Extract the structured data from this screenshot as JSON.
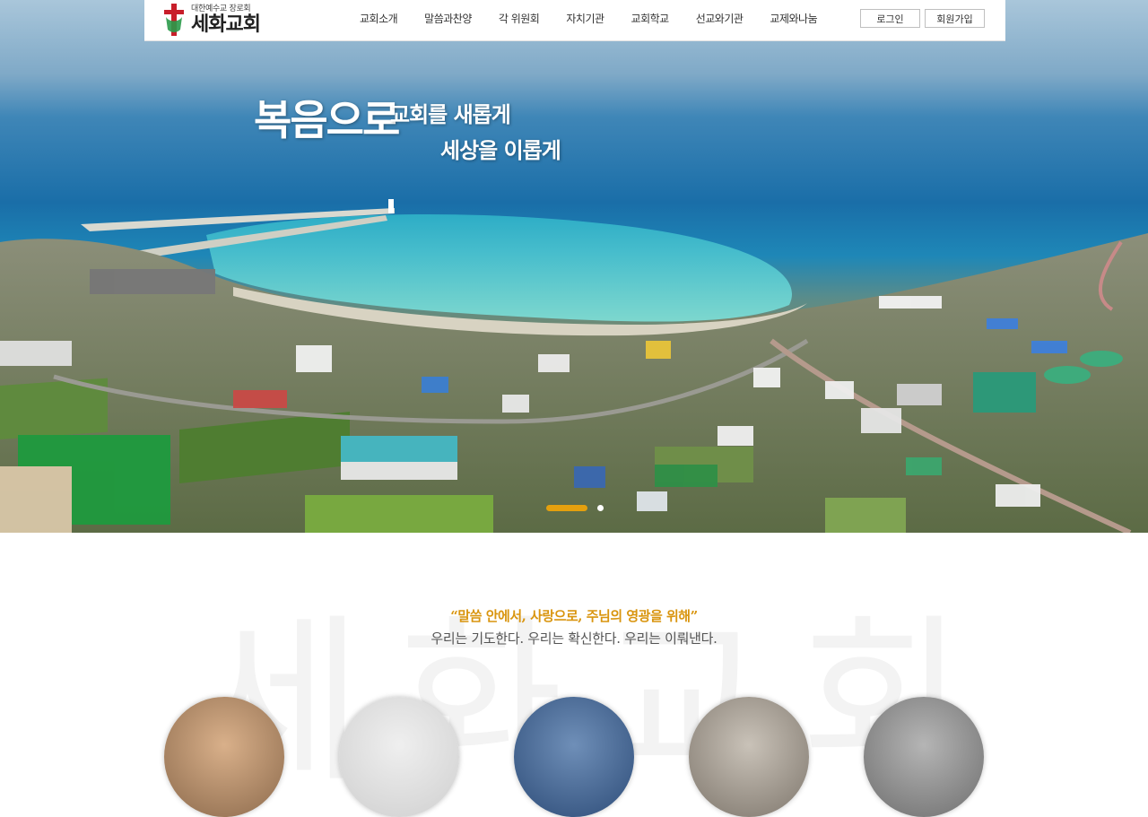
{
  "header": {
    "logo_small": "대한예수교 장로회",
    "logo_big": "세화교회",
    "nav": [
      "교회소개",
      "말씀과찬양",
      "각 위원회",
      "자치기관",
      "교회학교",
      "선교와기관",
      "교제와나눔"
    ],
    "login": "로그인",
    "signup": "회원가입"
  },
  "hero": {
    "slogan_main": "복음으로",
    "slogan_line1": "교회를 새롭게",
    "slogan_line2": "세상을 이롭게",
    "slides_total": 2,
    "active_slide": 1
  },
  "intro": {
    "watermark": "세화교회",
    "motto_quote": "“말씀 안에서, 사랑으로, 주님의 영광을 위해”",
    "motto_sub": "우리는 기도한다. 우리는 확신한다. 우리는 이뤄낸다."
  },
  "colors": {
    "accent": "#e4a00e",
    "motto": "#d9950f"
  }
}
